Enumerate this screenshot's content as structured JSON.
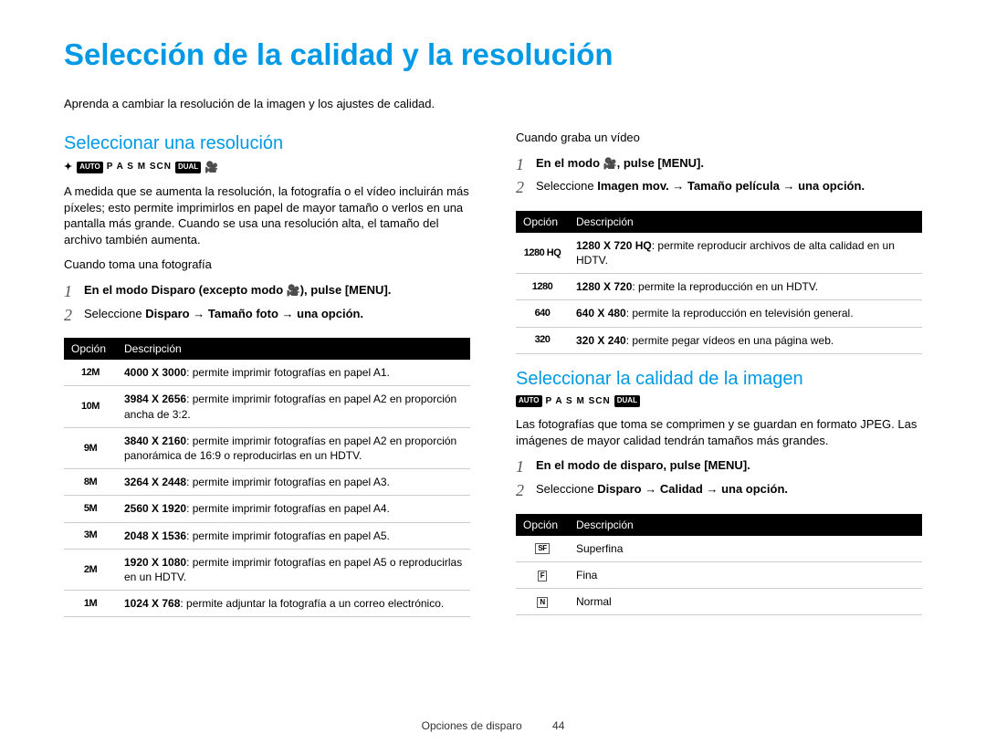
{
  "page_title": "Selección de la calidad y la resolución",
  "intro": "Aprenda a cambiar la resolución de la imagen y los ajustes de calidad.",
  "sec_res": {
    "heading": "Seleccionar una resolución",
    "modes_text": "P  A  S  M        SCN",
    "modes_auto": "AUTO",
    "modes_dual": "DUAL",
    "body": "A medida que se aumenta la resolución, la fotografía o el vídeo incluirán más píxeles; esto permite imprimirlos en papel de mayor tamaño o verlos en una pantalla más grande. Cuando se usa una resolución alta, el tamaño del archivo también aumenta.",
    "photo_subhead": "Cuando toma una fotografía",
    "photo_steps": [
      {
        "pre": "En el modo Disparo (excepto modo ",
        "glyph": "🎥",
        "mid": "), pulse [",
        "menu": "MENU",
        "post": "]."
      },
      {
        "text_a": "Seleccione ",
        "b1": "Disparo",
        "arrow1": " → ",
        "b2": "Tamaño foto",
        "arrow2": " → ",
        "b3": "una opción."
      }
    ],
    "table_headers": {
      "opt": "Opción",
      "desc": "Descripción"
    },
    "photo_table": [
      {
        "opt": "12M",
        "res": "4000 X 3000",
        "desc": ": permite imprimir fotografías en papel A1."
      },
      {
        "opt": "10M",
        "res": "3984 X 2656",
        "desc": ": permite imprimir fotografías en papel A2 en proporción ancha de 3:2."
      },
      {
        "opt": "9M",
        "res": "3840 X 2160",
        "desc": ": permite imprimir fotografías en papel A2 en proporción panorámica de 16:9 o reproducirlas en un HDTV."
      },
      {
        "opt": "8M",
        "res": "3264 X 2448",
        "desc": ": permite imprimir fotografías en papel A3."
      },
      {
        "opt": "5M",
        "res": "2560 X 1920",
        "desc": ": permite imprimir fotografías en papel A4."
      },
      {
        "opt": "3M",
        "res": "2048 X 1536",
        "desc": ": permite imprimir fotografías en papel A5."
      },
      {
        "opt": "2M",
        "res": "1920 X 1080",
        "desc": ": permite imprimir fotografías en papel A5 o reproducirlas en un HDTV."
      },
      {
        "opt": "1M",
        "res": "1024 X 768",
        "desc": ": permite adjuntar la fotografía a un correo electrónico."
      }
    ],
    "video_subhead": "Cuando graba un vídeo",
    "video_steps": [
      {
        "pre": "En el modo ",
        "glyph": "🎥",
        "mid": ", pulse [",
        "menu": "MENU",
        "post": "]."
      },
      {
        "text_a": "Seleccione ",
        "b1": "Imagen mov.",
        "arrow1": " → ",
        "b2": "Tamaño película",
        "arrow2": " → ",
        "b3": "una opción."
      }
    ],
    "video_table": [
      {
        "opt": "1280 HQ",
        "res": "1280 X 720 HQ",
        "desc": ": permite reproducir archivos de alta calidad en un HDTV."
      },
      {
        "opt": "1280",
        "res": "1280 X 720",
        "desc": ": permite la reproducción en un HDTV."
      },
      {
        "opt": "640",
        "res": "640 X 480",
        "desc": ": permite la reproducción en televisión general."
      },
      {
        "opt": "320",
        "res": "320 X 240",
        "desc": ": permite pegar vídeos en una página web."
      }
    ]
  },
  "sec_qual": {
    "heading": "Seleccionar la calidad de la imagen",
    "modes_text": "P  A  S  M        SCN",
    "modes_auto": "AUTO",
    "modes_dual": "DUAL",
    "body": "Las fotografías que toma se comprimen y se guardan en formato JPEG. Las imágenes de mayor calidad tendrán tamaños más grandes.",
    "steps": [
      {
        "pre": "En el modo de disparo, pulse [",
        "menu": "MENU",
        "post": "]."
      },
      {
        "text_a": "Seleccione ",
        "b1": "Disparo",
        "arrow1": " → ",
        "b2": "Calidad",
        "arrow2": " → ",
        "b3": "una opción."
      }
    ],
    "table": [
      {
        "icon": "SF",
        "label": "Superfina"
      },
      {
        "icon": "F",
        "label": "Fina"
      },
      {
        "icon": "N",
        "label": "Normal"
      }
    ]
  },
  "footer": {
    "section": "Opciones de disparo",
    "page": "44"
  }
}
